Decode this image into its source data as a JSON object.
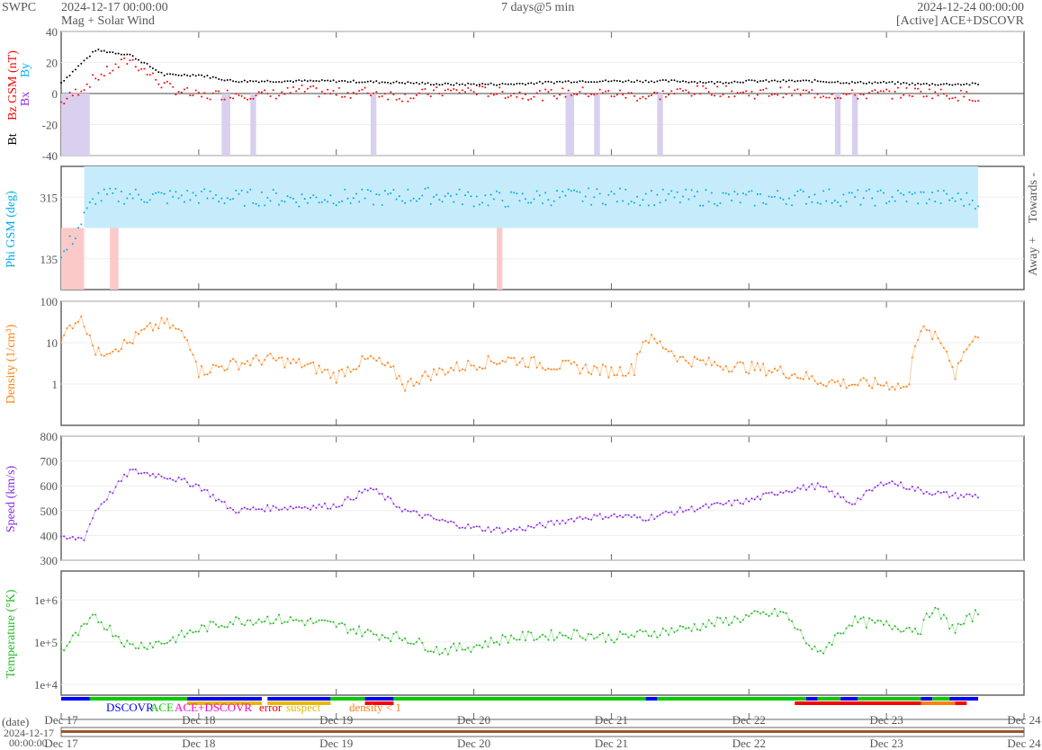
{
  "header": {
    "org": "SWPC",
    "start": "2024-12-17 00:00:00",
    "product": "Mag + Solar Wind",
    "span": "7 days@5 min",
    "end": "2024-12-24 00:00:00",
    "source": "[Active] ACE+DSCOVR"
  },
  "legend": {
    "dscovr": "DSCOVR",
    "ace": "ACE",
    "both": "ACE+DSCOVR",
    "error": "error",
    "suspect": "suspect",
    "density": "density < 1"
  },
  "bottom": {
    "date_label": "(date)",
    "date_value": "2024-12-17",
    "time_value": "00:00:00"
  },
  "colors": {
    "bt": "#000000",
    "bz": "#ff0000",
    "phi": "#00aaee",
    "density": "#ff7f0e",
    "speed": "#8a2be2",
    "temp": "#22bb22",
    "dscovr": "#0000ff",
    "ace": "#00cc00",
    "both": "#ff00ff"
  },
  "chart_data": [
    {
      "type": "line",
      "title": "Magnetic field",
      "ylabel": "Bt  Bz GSM (nT)",
      "ylabel_parts": [
        "Bt",
        "Bz GSM (nT)",
        "Bx",
        "By"
      ],
      "ylim": [
        -40,
        40
      ],
      "yticks": [
        "40",
        "20",
        "0",
        "-20",
        "-40"
      ],
      "x_hours": [
        0,
        6,
        12,
        18,
        24,
        30,
        36,
        42,
        48,
        54,
        60,
        66,
        72,
        78,
        84,
        90,
        96,
        102,
        108,
        114,
        120,
        126,
        132,
        138,
        144,
        150,
        156,
        160
      ],
      "series": [
        {
          "name": "Bt",
          "values": [
            7,
            28,
            25,
            12,
            12,
            8,
            8,
            8,
            8,
            7.5,
            7,
            6,
            6,
            6,
            7,
            8,
            8,
            8,
            8,
            7,
            8,
            8,
            8,
            7,
            7,
            6,
            6,
            6
          ]
        },
        {
          "name": "Bz",
          "values": [
            -6,
            10,
            22,
            5,
            -2,
            0,
            -1,
            2,
            0,
            1,
            -2,
            1,
            2,
            0,
            -1,
            1,
            0,
            -2,
            1,
            2,
            0,
            1,
            0,
            -1,
            0,
            1,
            -1,
            -2
          ]
        }
      ]
    },
    {
      "type": "scatter",
      "title": "Phi",
      "ylabel": "Phi GSM (deg)",
      "yticks": [
        "315",
        "135"
      ],
      "ylim": [
        45,
        405
      ],
      "right_labels": [
        "Towards -",
        "Away +"
      ],
      "x_hours": [
        0,
        6,
        12,
        18,
        24,
        30,
        36,
        42,
        48,
        54,
        60,
        66,
        72,
        78,
        84,
        90,
        96,
        102,
        108,
        114,
        120,
        126,
        132,
        138,
        144,
        150,
        156,
        160
      ],
      "values": [
        135,
        315,
        320,
        315,
        318,
        312,
        315,
        310,
        315,
        312,
        318,
        320,
        312,
        308,
        315,
        316,
        318,
        315,
        312,
        315,
        310,
        315,
        318,
        312,
        315,
        316,
        310,
        305
      ]
    },
    {
      "type": "line",
      "title": "Density",
      "ylabel": "Density (1/cm³)",
      "yscale": "log",
      "ylim": [
        0.1,
        100
      ],
      "yticks": [
        "100",
        "10",
        "1"
      ],
      "x_hours": [
        0,
        3,
        6,
        12,
        18,
        24,
        30,
        36,
        42,
        48,
        54,
        60,
        66,
        72,
        78,
        84,
        90,
        96,
        100,
        102,
        108,
        114,
        120,
        126,
        132,
        138,
        144,
        148,
        150,
        152,
        156,
        160
      ],
      "values": [
        9,
        40,
        5,
        10,
        30,
        2,
        3,
        4,
        3,
        1.5,
        4,
        0.9,
        2,
        3,
        4,
        3,
        2.5,
        2,
        2.3,
        13,
        4,
        3,
        2.5,
        2,
        1.2,
        1.0,
        1.0,
        0.8,
        20,
        15,
        1.3,
        15
      ]
    },
    {
      "type": "line",
      "title": "Speed",
      "ylabel": "Speed (km/s)",
      "ylim": [
        300,
        800
      ],
      "yticks": [
        "800",
        "700",
        "600",
        "500",
        "400",
        "300"
      ],
      "x_hours": [
        0,
        4,
        6,
        12,
        18,
        24,
        30,
        36,
        42,
        48,
        54,
        60,
        66,
        72,
        78,
        84,
        90,
        96,
        102,
        108,
        114,
        120,
        126,
        132,
        138,
        144,
        150,
        156,
        160
      ],
      "values": [
        385,
        390,
        500,
        660,
        640,
        600,
        500,
        510,
        515,
        520,
        590,
        500,
        460,
        430,
        420,
        440,
        470,
        480,
        470,
        500,
        520,
        540,
        580,
        600,
        530,
        620,
        580,
        560,
        560
      ]
    },
    {
      "type": "line",
      "title": "Temperature",
      "ylabel": "Temperature (°K)",
      "yscale": "log",
      "ylim": [
        6000,
        2000000
      ],
      "yticks": [
        "1e+6",
        "1e+5",
        "1e+4"
      ],
      "x_hours": [
        0,
        6,
        12,
        18,
        24,
        30,
        36,
        42,
        48,
        54,
        60,
        66,
        72,
        78,
        84,
        90,
        96,
        102,
        108,
        114,
        120,
        126,
        132,
        138,
        144,
        150,
        152,
        156,
        160
      ],
      "log10_values": [
        4.8,
        5.6,
        4.9,
        5.0,
        5.3,
        5.5,
        5.55,
        5.5,
        5.4,
        5.2,
        5.1,
        4.8,
        4.9,
        5.1,
        5.15,
        5.2,
        5.1,
        5.2,
        5.3,
        5.45,
        5.6,
        5.7,
        4.7,
        5.5,
        5.4,
        5.3,
        5.8,
        5.3,
        5.7
      ]
    },
    {
      "type": "bar",
      "title": "Source",
      "segments": [
        {
          "source": "DSCOVR",
          "from_h": 0,
          "to_h": 5
        },
        {
          "source": "ACE",
          "from_h": 5,
          "to_h": 22
        },
        {
          "source": "DSCOVR",
          "from_h": 22,
          "to_h": 35
        },
        {
          "source": "DSCOVR",
          "from_h": 36,
          "to_h": 47
        },
        {
          "source": "ACE",
          "from_h": 47,
          "to_h": 53
        },
        {
          "source": "DSCOVR",
          "from_h": 53,
          "to_h": 58
        },
        {
          "source": "ACE",
          "from_h": 58,
          "to_h": 102
        },
        {
          "source": "DSCOVR",
          "from_h": 102,
          "to_h": 104
        },
        {
          "source": "ACE",
          "from_h": 104,
          "to_h": 130
        },
        {
          "source": "DSCOVR",
          "from_h": 130,
          "to_h": 132
        },
        {
          "source": "ACE",
          "from_h": 132,
          "to_h": 136
        },
        {
          "source": "DSCOVR",
          "from_h": 136,
          "to_h": 139
        },
        {
          "source": "ACE",
          "from_h": 139,
          "to_h": 150
        },
        {
          "source": "DSCOVR",
          "from_h": 150,
          "to_h": 152
        },
        {
          "source": "ACE",
          "from_h": 152,
          "to_h": 155
        },
        {
          "source": "DSCOVR",
          "from_h": 155,
          "to_h": 160
        }
      ]
    }
  ],
  "xaxis": {
    "ticks": [
      "Dec 17",
      "Dec 18",
      "Dec 19",
      "Dec 20",
      "Dec 21",
      "Dec 22",
      "Dec 23",
      "Dec 24"
    ]
  }
}
